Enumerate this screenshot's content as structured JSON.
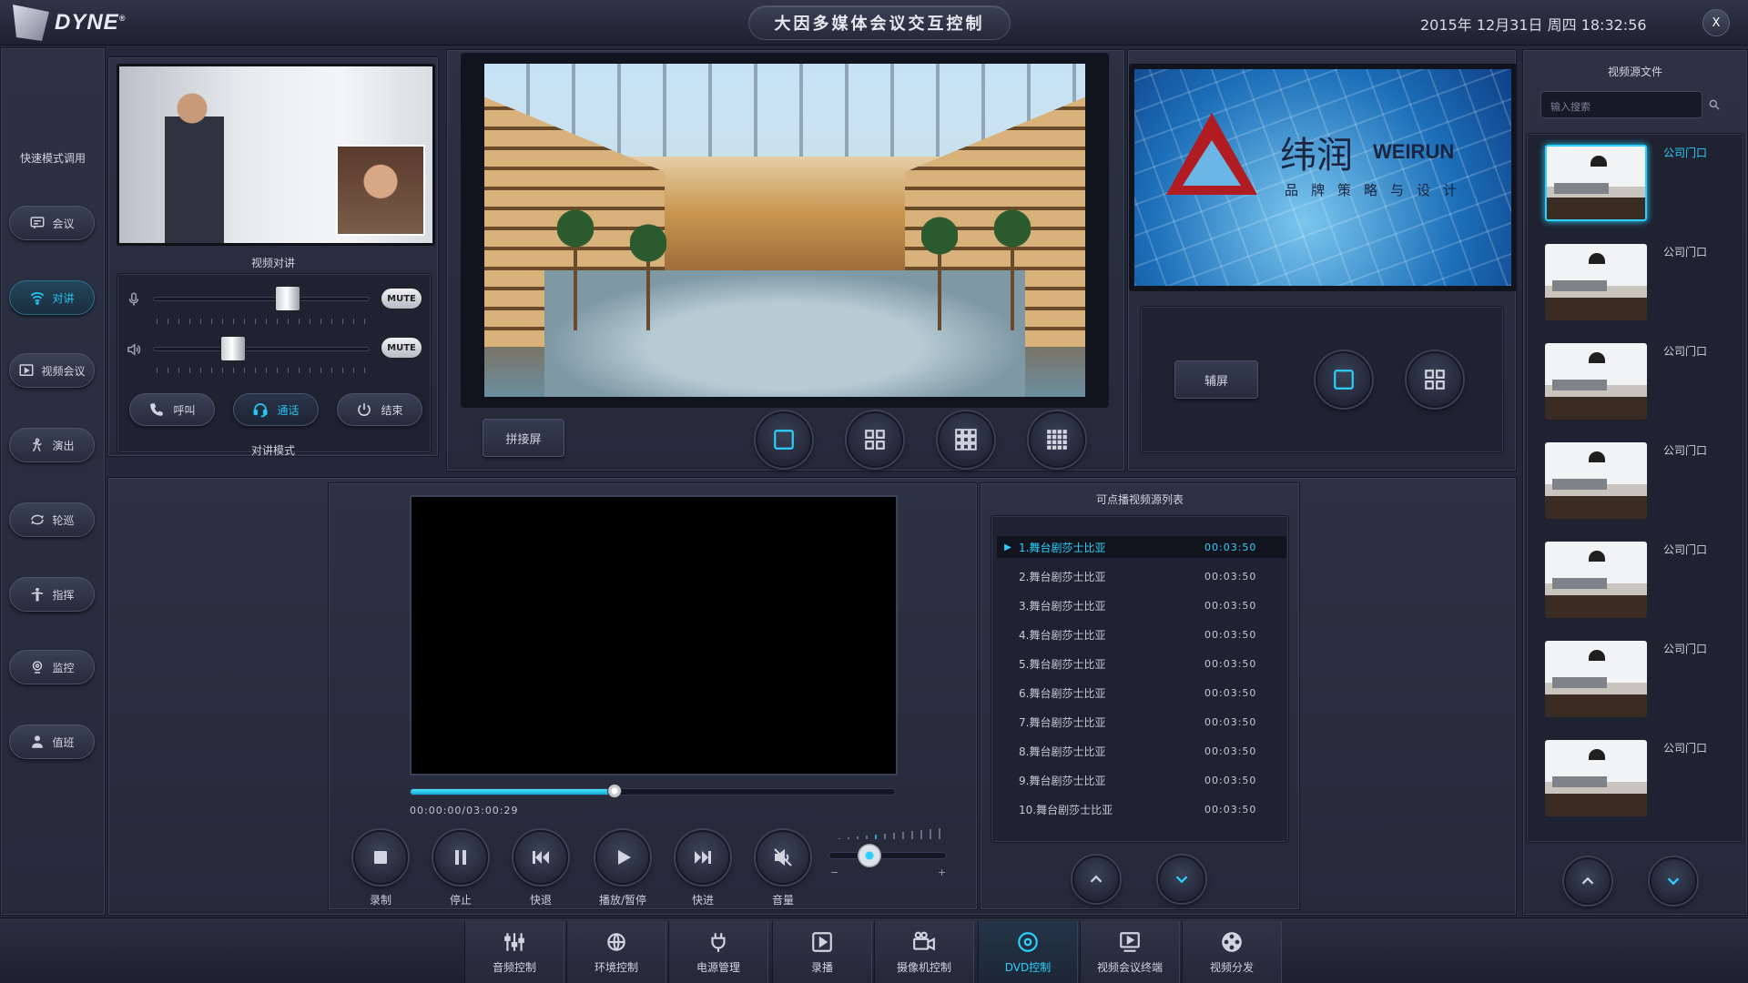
{
  "header": {
    "logo_text": "DYNE",
    "title": "大因多媒体会议交互控制",
    "datetime": "2015年 12月31日 周四 18:32:56",
    "close_label": "X"
  },
  "sidebar": {
    "section_label": "快速模式调用",
    "items": [
      {
        "label": "会议",
        "icon": "meeting-icon"
      },
      {
        "label": "对讲",
        "icon": "wifi-icon",
        "active": true
      },
      {
        "label": "视频会议",
        "icon": "video-conference-icon"
      },
      {
        "label": "演出",
        "icon": "performance-icon"
      },
      {
        "label": "轮巡",
        "icon": "cycle-icon"
      },
      {
        "label": "指挥",
        "icon": "command-icon"
      },
      {
        "label": "监控",
        "icon": "monitor-icon"
      },
      {
        "label": "值班",
        "icon": "duty-icon"
      }
    ]
  },
  "intercom": {
    "title": "视频对讲",
    "mode_label": "对讲模式",
    "mute_label": "MUTE",
    "mic_level": 0.64,
    "speaker_level": 0.35,
    "buttons": [
      {
        "label": "呼叫",
        "icon": "phone-icon"
      },
      {
        "label": "通话",
        "icon": "headset-icon",
        "active": true
      },
      {
        "label": "结束",
        "icon": "power-icon"
      }
    ]
  },
  "main_screen": {
    "splice_label": "拼接屏",
    "layouts": [
      "single-layout-icon",
      "grid-4-layout-icon",
      "grid-9-layout-icon",
      "grid-16-layout-icon"
    ]
  },
  "aux_screen": {
    "label": "辅屏",
    "brand_cn": "纬润",
    "brand_en": "WEIRUN",
    "slogan": "品牌策略与设计",
    "layouts": [
      "single-layout-icon",
      "grid-4-layout-icon"
    ]
  },
  "sources": {
    "title": "视频源文件",
    "search_placeholder": "输入搜索",
    "items": [
      {
        "label": "公司门口",
        "selected": true
      },
      {
        "label": "公司门口"
      },
      {
        "label": "公司门口"
      },
      {
        "label": "公司门口"
      },
      {
        "label": "公司门口"
      },
      {
        "label": "公司门口"
      },
      {
        "label": "公司门口"
      }
    ]
  },
  "player": {
    "time": "00:00:00/03:00:29",
    "progress": 0.42,
    "volume": 0.3,
    "controls": [
      {
        "label": "录制",
        "icon": "record-icon"
      },
      {
        "label": "停止",
        "icon": "pause-icon"
      },
      {
        "label": "快退",
        "icon": "rewind-icon"
      },
      {
        "label": "播放/暂停",
        "icon": "play-icon"
      },
      {
        "label": "快进",
        "icon": "fast-forward-icon"
      },
      {
        "label": "音量",
        "icon": "mute-speaker-icon"
      }
    ],
    "volume_min": "−",
    "volume_max": "+"
  },
  "playlist": {
    "title": "可点播视频源列表",
    "items": [
      {
        "label": "1.舞台剧莎士比亚",
        "duration": "00:03:50",
        "active": true
      },
      {
        "label": "2.舞台剧莎士比亚",
        "duration": "00:03:50"
      },
      {
        "label": "3.舞台剧莎士比亚",
        "duration": "00:03:50"
      },
      {
        "label": "4.舞台剧莎士比亚",
        "duration": "00:03:50"
      },
      {
        "label": "5.舞台剧莎士比亚",
        "duration": "00:03:50"
      },
      {
        "label": "6.舞台剧莎士比亚",
        "duration": "00:03:50"
      },
      {
        "label": "7.舞台剧莎士比亚",
        "duration": "00:03:50"
      },
      {
        "label": "8.舞台剧莎士比亚",
        "duration": "00:03:50"
      },
      {
        "label": "9.舞台剧莎士比亚",
        "duration": "00:03:50"
      },
      {
        "label": "10.舞台剧莎士比亚",
        "duration": "00:03:50"
      }
    ]
  },
  "bottom_nav": {
    "items": [
      {
        "label": "音频控制",
        "icon": "audio-mixer-icon"
      },
      {
        "label": "环境控制",
        "icon": "environment-icon"
      },
      {
        "label": "电源管理",
        "icon": "power-plug-icon"
      },
      {
        "label": "录播",
        "icon": "play-box-icon"
      },
      {
        "label": "摄像机控制",
        "icon": "camera-icon"
      },
      {
        "label": "DVD控制",
        "icon": "dvd-icon",
        "active": true
      },
      {
        "label": "视频会议终端",
        "icon": "video-terminal-icon"
      },
      {
        "label": "视频分发",
        "icon": "film-reel-icon"
      }
    ]
  },
  "colors": {
    "accent": "#2ad1ff",
    "background": "#23283a",
    "panel": "#2c3143"
  }
}
